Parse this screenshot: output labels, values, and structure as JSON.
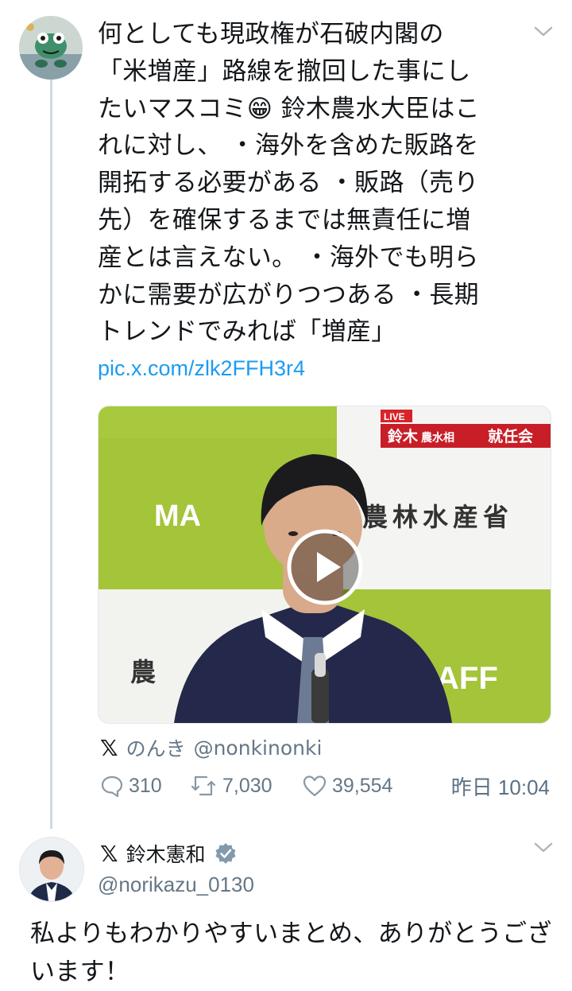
{
  "tweet": {
    "text": "何としても現政権が石破内閣の\n「米増産」路線を撤回した事にし\nたいマスコミ😁 鈴木農水大臣はこ\nれに対し、 ・海外を含めた販路を\n開拓する必要がある ・販路（売り\n先）を確保するまでは無責任に増\n産とは言えない。 ・海外でも明ら\nかに需要が広がりつつある ・長期\nトレンドでみれば「増産」",
    "link": "pic.x.com/zlk2FFH3r4",
    "media": {
      "live_badge": "LIVE",
      "caption_name": "鈴木",
      "caption_title": "農水相",
      "caption_event": "就任会",
      "sign_ministry": "農林水産省",
      "sign_maff_left": "MA",
      "sign_maff_right": "AFF",
      "sign_kanji_left": "農"
    },
    "source_name": "のんき",
    "source_handle": "@nonkinonki",
    "replies": "310",
    "retweets": "7,030",
    "likes": "39,554",
    "timestamp": "昨日 10:04"
  },
  "reply": {
    "name": "鈴木憲和",
    "handle": "@norikazu_0130",
    "text": "私よりもわかりやすいまとめ、ありがとうございます！"
  },
  "colors": {
    "link": "#1d9bf0",
    "meta": "#657786",
    "verified": "#829aab"
  },
  "icons": [
    "chevron-down-icon",
    "x-logo-icon",
    "reply-icon",
    "retweet-icon",
    "like-icon",
    "verified-badge-icon",
    "play-icon"
  ]
}
